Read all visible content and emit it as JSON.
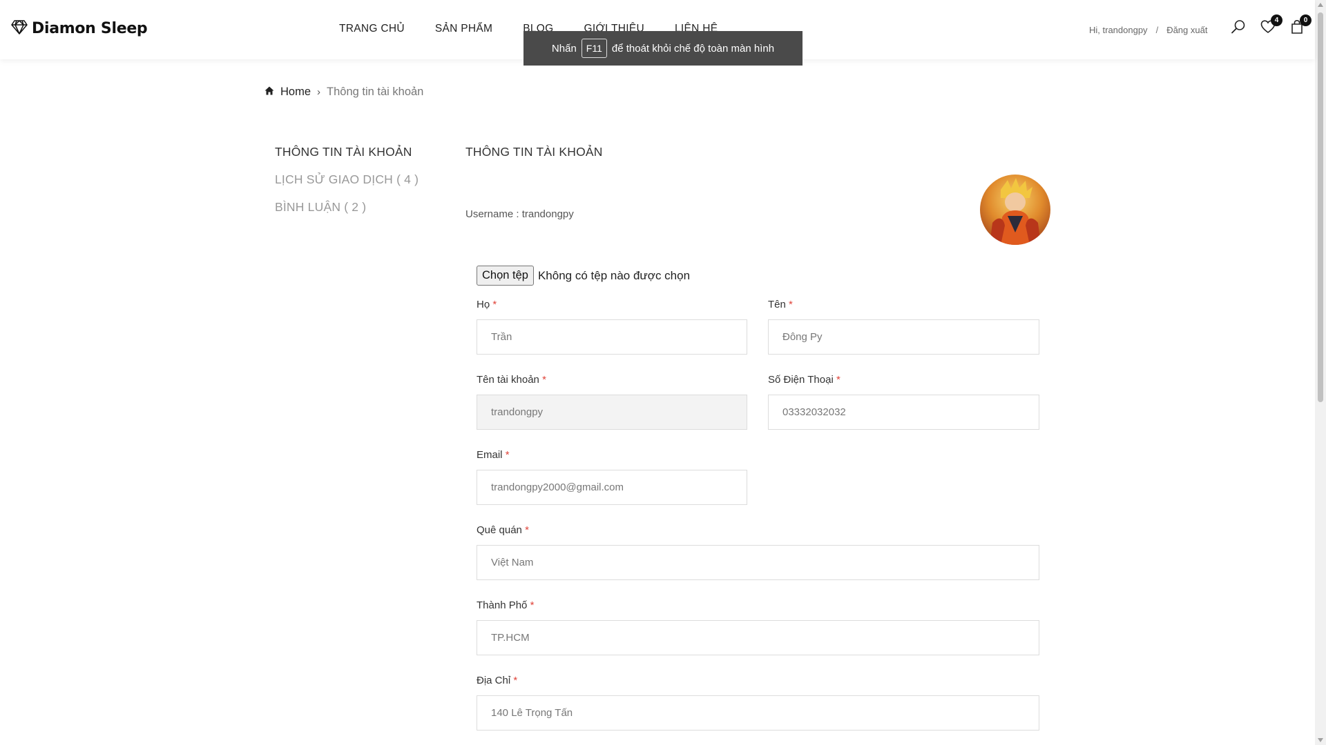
{
  "header": {
    "logo_text": "Diamon Sleep",
    "nav": [
      "TRANG CHỦ",
      "SẢN PHẨM",
      "BLOG",
      "GIỚI THIỆU",
      "LIÊN HỆ"
    ],
    "greeting": "Hi, trandongpy",
    "separator": "/",
    "logout": "Đăng xuất",
    "wishlist_count": "4",
    "cart_count": "0"
  },
  "toast": {
    "before": "Nhấn",
    "key": "F11",
    "after": "để thoát khỏi chế độ toàn màn hình"
  },
  "breadcrumb": {
    "home": "Home",
    "current": "Thông tin tài khoản"
  },
  "sidebar": {
    "items": [
      "THÔNG TIN TÀI KHOẢN",
      "LỊCH SỬ GIAO DỊCH ( 4 )",
      "BÌNH LUẬN ( 2 )"
    ]
  },
  "main": {
    "title": "THÔNG TIN TÀI KHOẢN",
    "username_line": "Username : trandongpy"
  },
  "file_input": {
    "button": "Chọn tệp",
    "status": "Không có tệp nào được chọn"
  },
  "form": {
    "last_name": {
      "label": "Họ",
      "value": "Trần"
    },
    "first_name": {
      "label": "Tên",
      "value": "Đông Py"
    },
    "account": {
      "label": "Tên tài khoản",
      "value": "trandongpy"
    },
    "phone": {
      "label": "Số Điện Thoại",
      "value": "03332032032"
    },
    "email": {
      "label": "Email",
      "value": "trandongpy2000@gmail.com"
    },
    "hometown": {
      "label": "Quê quán",
      "value": "Việt Nam"
    },
    "city": {
      "label": "Thành Phố",
      "value": "TP.HCM"
    },
    "address": {
      "label": "Địa Chỉ",
      "value": "140 Lê Trọng Tấn"
    },
    "required_mark": "*"
  },
  "colors": {
    "required": "#e0443a",
    "toast_bg": "#4a4a4a",
    "badge_bg": "#111111"
  }
}
